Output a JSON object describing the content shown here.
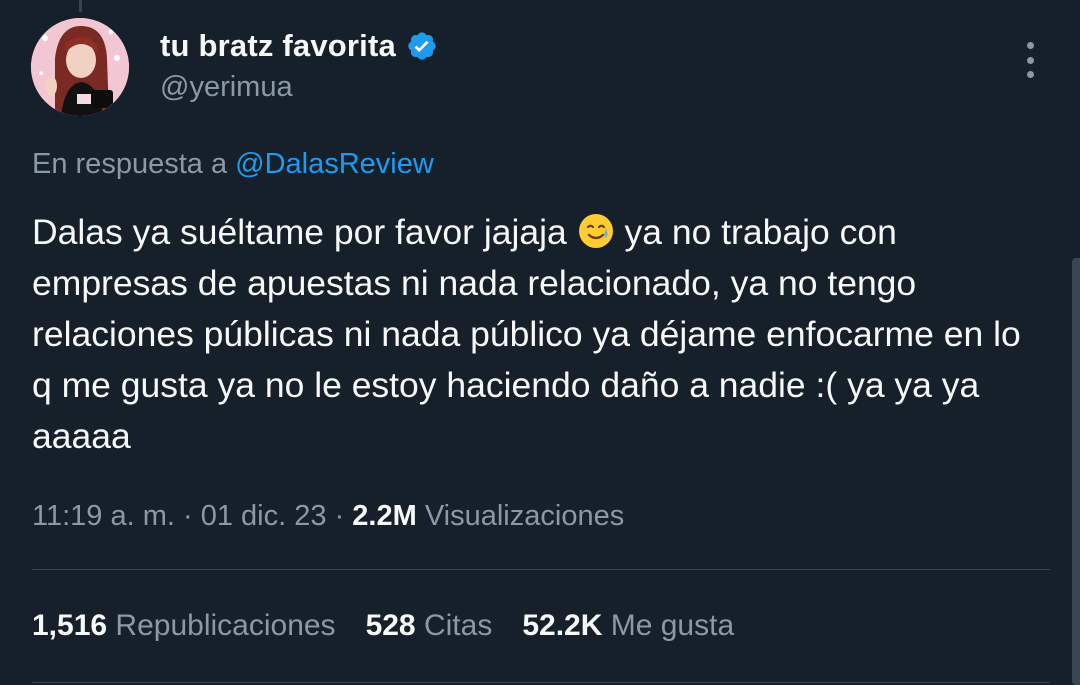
{
  "author": {
    "display_name": "tu bratz favorita",
    "handle": "@yerimua",
    "verified": true,
    "verified_color": "#1d9bf0"
  },
  "reply": {
    "prefix": "En respuesta a ",
    "mention": "@DalasReview"
  },
  "tweet": {
    "text_before_emoji": "Dalas ya suéltame por favor jajaja ",
    "emoji": "smiling-face-with-tear",
    "text_after_emoji": " ya no trabajo con empresas de apuestas ni nada relacionado, ya no tengo relaciones públicas ni nada público ya déjame enfocarme en lo q me gusta ya no le estoy haciendo daño a nadie :( ya ya ya aaaaa"
  },
  "meta": {
    "time": "11:19 a. m.",
    "separator": "·",
    "date": "01 dic. 23",
    "views_count": "2.2M",
    "views_label": "Visualizaciones"
  },
  "stats": [
    {
      "count": "1,516",
      "label": "Republicaciones"
    },
    {
      "count": "528",
      "label": "Citas"
    },
    {
      "count": "52.2K",
      "label": "Me gusta"
    }
  ],
  "colors": {
    "background": "#15202b",
    "text": "#f7f9f9",
    "secondary": "#8b98a5",
    "link": "#1d9bf0",
    "divider": "#38444d"
  }
}
